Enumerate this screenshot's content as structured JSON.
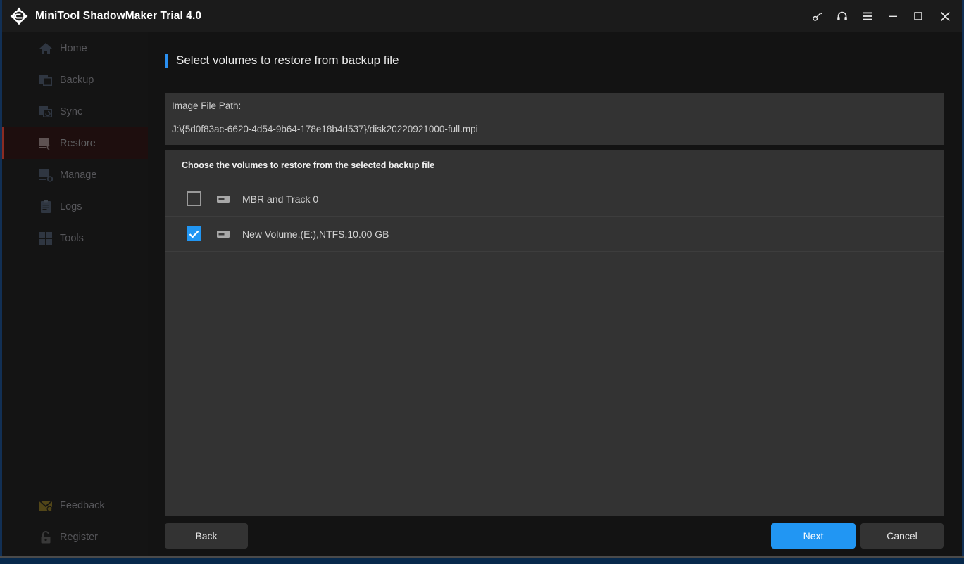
{
  "titlebar": {
    "app_title": "MiniTool ShadowMaker Trial 4.0",
    "logo_icon": "refresh-circular-arrows-logo",
    "controls": [
      {
        "name": "key-icon",
        "label": "Key"
      },
      {
        "name": "headset-icon",
        "label": "Support"
      },
      {
        "name": "menu-icon",
        "label": "Menu"
      },
      {
        "name": "minimize-icon",
        "label": "Minimize"
      },
      {
        "name": "maximize-icon",
        "label": "Maximize"
      },
      {
        "name": "close-icon",
        "label": "Close"
      }
    ]
  },
  "sidebar": {
    "items": [
      {
        "label": "Home",
        "icon": "home-icon",
        "active": false
      },
      {
        "label": "Backup",
        "icon": "backup-icon",
        "active": false
      },
      {
        "label": "Sync",
        "icon": "sync-icon",
        "active": false
      },
      {
        "label": "Restore",
        "icon": "restore-icon",
        "active": true
      },
      {
        "label": "Manage",
        "icon": "manage-icon",
        "active": false
      },
      {
        "label": "Logs",
        "icon": "logs-icon",
        "active": false
      },
      {
        "label": "Tools",
        "icon": "tools-icon",
        "active": false
      }
    ],
    "bottom_items": [
      {
        "label": "Feedback",
        "icon": "envelope-icon",
        "active": false
      },
      {
        "label": "Register",
        "icon": "lock-icon",
        "active": false
      }
    ],
    "active_accent": "#8a2b22"
  },
  "main": {
    "page_title": "Select volumes to restore from backup file",
    "title_accent_color": "#2a8ff0",
    "path_panel": {
      "label": "Image File Path:",
      "value": "J:\\{5d0f83ac-6620-4d54-9b64-178e18b4d537}/disk20220921000-full.mpi"
    },
    "list_header": "Choose the volumes to restore from the selected backup file",
    "volumes": [
      {
        "label": "MBR and Track 0",
        "checked": false,
        "icon": "drive-icon"
      },
      {
        "label": "New Volume,(E:),NTFS,10.00 GB",
        "checked": true,
        "icon": "drive-icon"
      }
    ]
  },
  "footer": {
    "back_label": "Back",
    "next_label": "Next",
    "cancel_label": "Cancel",
    "primary_color": "#2196f3"
  }
}
